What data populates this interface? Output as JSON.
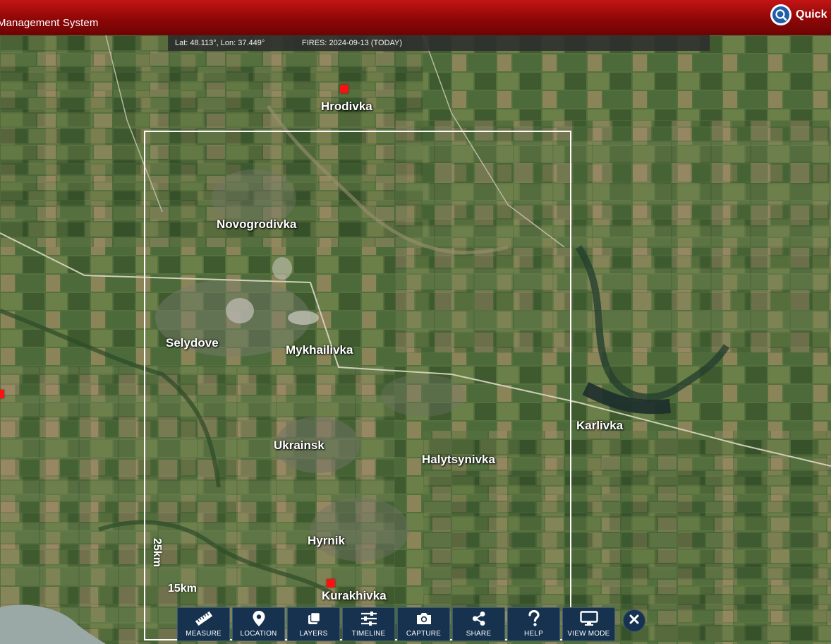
{
  "header": {
    "app_title": "Management System",
    "quick_label": "Quick",
    "brand_color": "#a50b0b"
  },
  "infobar": {
    "coords": "Lat: 48.113°, Lon: 37.449°",
    "fires": "FIRES: 2024-09-13 (TODAY)"
  },
  "map": {
    "places": [
      "Hrodivka",
      "Novogrodivka",
      "Selydove",
      "Mykhailivka",
      "Karlivka",
      "Ukrainsk",
      "Halytsynivka",
      "Hyrnik",
      "Kurakhivka"
    ],
    "scale_vertical": "25km",
    "scale_horizontal": "15km",
    "fire_color": "#ff1010"
  },
  "toolbar": {
    "buttons": [
      {
        "label": "MEASURE",
        "icon": "ruler-icon"
      },
      {
        "label": "LOCATION",
        "icon": "map-pin-icon"
      },
      {
        "label": "LAYERS",
        "icon": "layers-icon"
      },
      {
        "label": "TIMELINE",
        "icon": "sliders-icon"
      },
      {
        "label": "CAPTURE",
        "icon": "camera-icon"
      },
      {
        "label": "SHARE",
        "icon": "share-icon"
      },
      {
        "label": "HELP",
        "icon": "question-icon"
      },
      {
        "label": "VIEW MODE",
        "icon": "monitor-icon"
      }
    ],
    "close_icon": "close-icon"
  }
}
